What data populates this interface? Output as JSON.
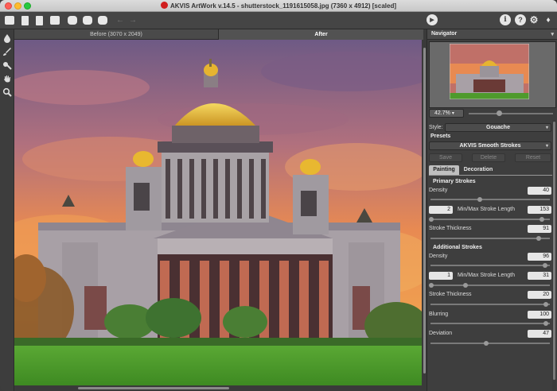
{
  "window": {
    "title": "AKVIS ArtWork v.14.5 - shutterstock_1191615058.jpg (7360 x 4912) [scaled]"
  },
  "toolbar": {
    "icons": [
      "open-image-icon",
      "save-image-icon",
      "export-icon",
      "print-icon",
      "share-icon",
      "batch-icon",
      "preset-icon",
      "undo-icon",
      "redo-icon"
    ],
    "undo_glyph": "←",
    "redo_glyph": "→",
    "run_glyph": "▶",
    "info_glyph": "i",
    "help_glyph": "?",
    "settings_glyph": "⚙",
    "plugin_glyph": "♦"
  },
  "tools": [
    "drop-icon",
    "brush-icon",
    "eraser-icon",
    "hand-icon",
    "zoom-icon"
  ],
  "view_tabs": {
    "before": "Before (3070 x 2049)",
    "after": "After"
  },
  "navigator": {
    "title": "Navigator",
    "zoom": "42.7%",
    "zoom_level": 0.7
  },
  "settings": {
    "style_label": "Style:",
    "style_value": "Gouache",
    "presets_label": "Presets",
    "preset_value": "AKVIS Smooth Strokes",
    "save_label": "Save",
    "delete_label": "Delete",
    "reset_label": "Reset",
    "tabs": [
      "Painting",
      "Decoration"
    ],
    "primary": {
      "title": "Primary Strokes",
      "density_label": "Density",
      "density": "40",
      "length_label": "Min/Max Stroke Length",
      "length_min": "2",
      "length_max": "153",
      "thickness_label": "Stroke Thickness",
      "thickness": "91"
    },
    "additional": {
      "title": "Additional Strokes",
      "density_label": "Density",
      "density": "96",
      "length_label": "Min/Max Stroke Length",
      "length_min": "1",
      "length_max": "31",
      "thickness_label": "Stroke Thickness",
      "thickness": "20"
    },
    "blurring_label": "Blurring",
    "blurring": "100",
    "deviation_label": "Deviation",
    "deviation": "47"
  },
  "colors": {
    "sky_top": "#7a5a86",
    "sky_glow": "#f08a40",
    "dome_gold": "#e8b830",
    "stone": "#b4aeb0",
    "grass": "#4e9a2c"
  }
}
